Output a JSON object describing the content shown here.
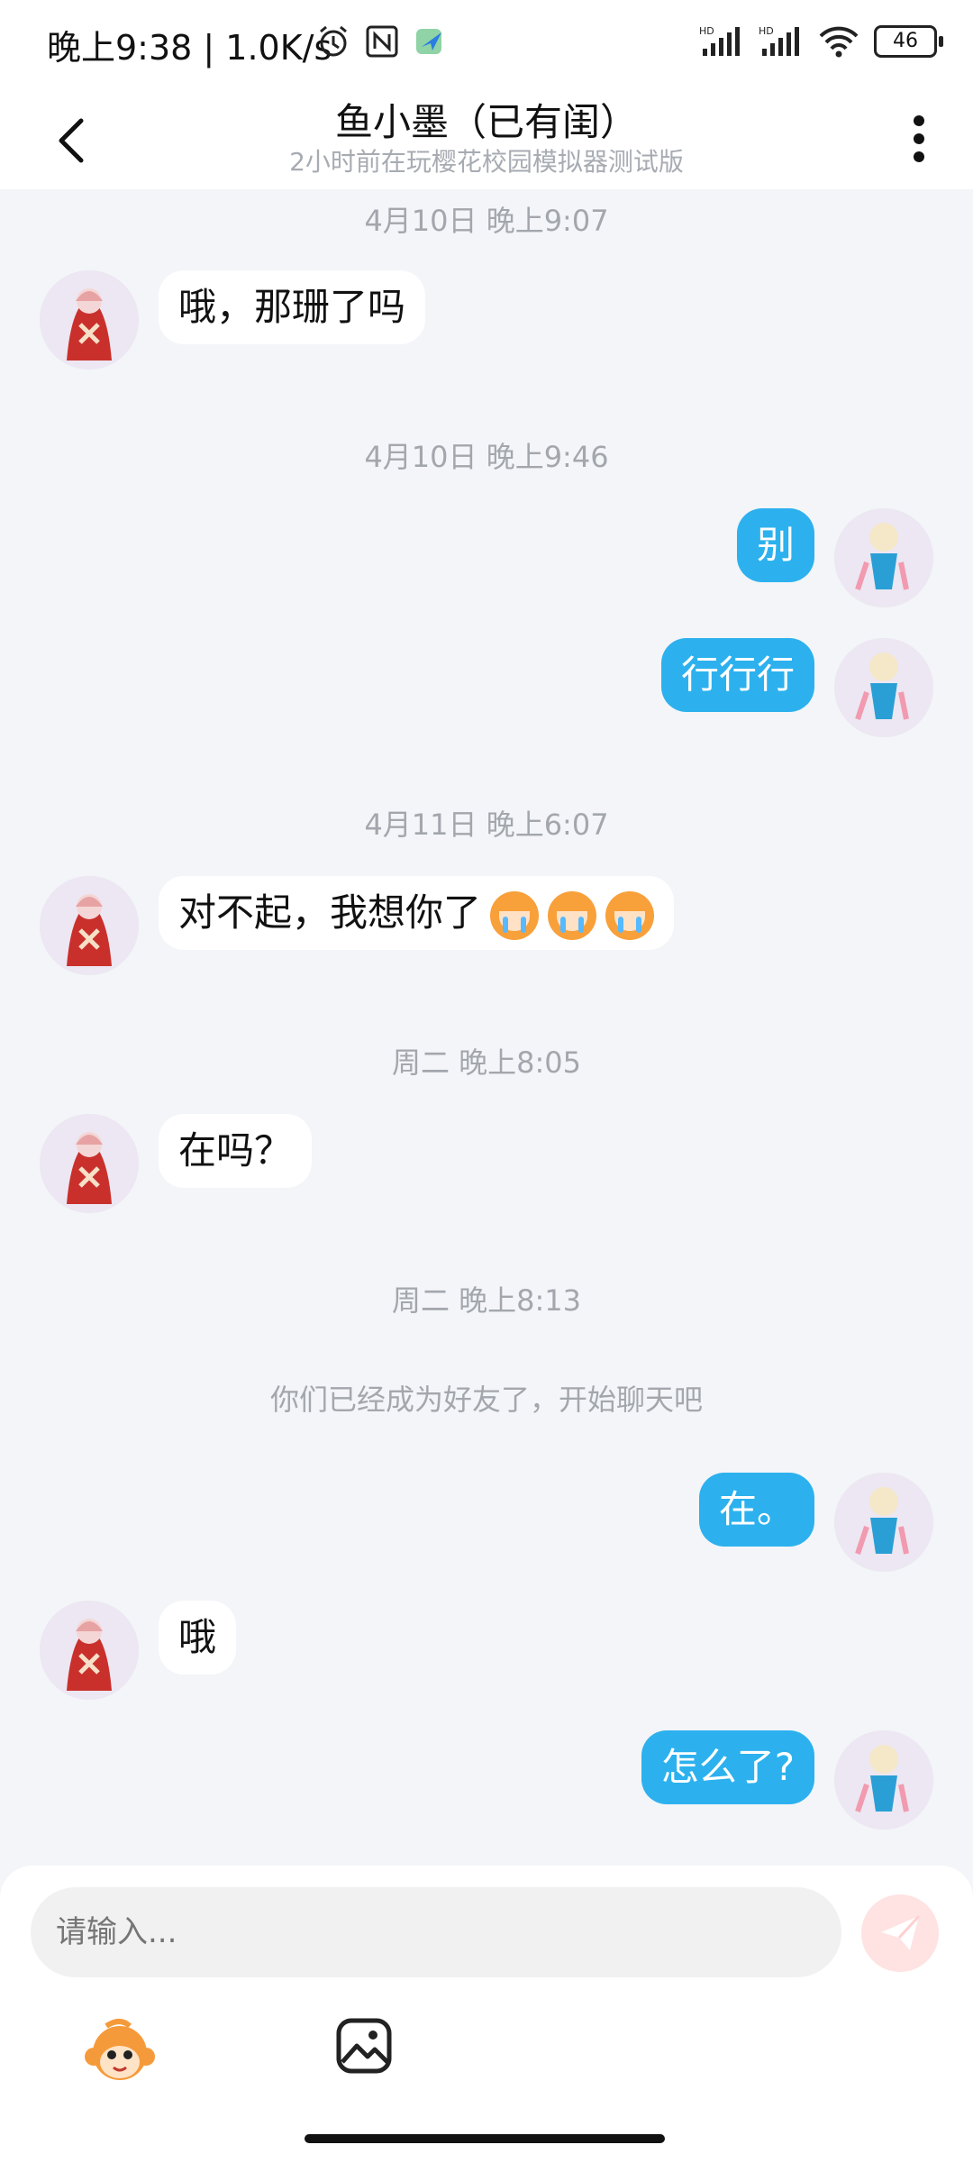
{
  "status_bar": {
    "time": "晚上9:38 | 1.0K/s",
    "battery": "46"
  },
  "header": {
    "title": "鱼小墨（已有闺）",
    "subtitle": "2小时前在玩樱花校园模拟器测试版"
  },
  "messages": {
    "ts1": "4月10日 晚上9:07",
    "m1": "哦，那珊了吗",
    "ts2": "4月10日 晚上9:46",
    "m2": "别",
    "m3": "行行行",
    "ts3": "4月11日 晚上6:07",
    "m4": "对不起，我想你了",
    "ts4": "周二 晚上8:05",
    "m5": "在吗？",
    "ts5": "周二 晚上8:13",
    "system": "你们已经成为好友了，开始聊天吧",
    "m6": "在。",
    "m7": "哦",
    "m8": "怎么了?"
  },
  "input": {
    "placeholder": "请输入..."
  },
  "colors": {
    "out_bubble": "#2cb1ee",
    "in_bubble": "#ffffff",
    "background": "#f3f5f8",
    "send_button": "#ffe2e2"
  },
  "icons": {
    "back": "chevron-left-icon",
    "more": "more-vertical-icon",
    "send": "paper-plane-icon",
    "emoji": "monkey-emoji-icon",
    "image": "image-icon"
  }
}
